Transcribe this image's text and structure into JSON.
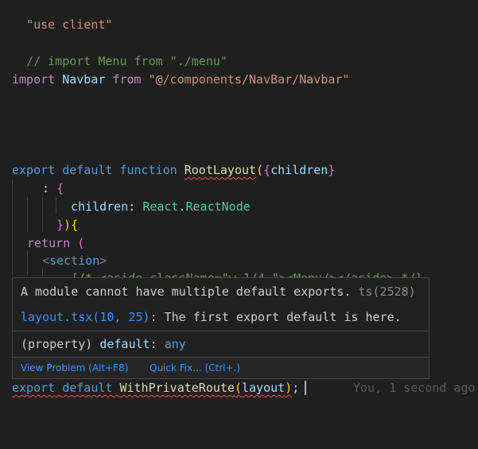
{
  "editor": {
    "l1": {
      "text": "\"use client\""
    },
    "l2": {
      "text": "// import Menu from \"./menu\""
    },
    "l3": {
      "kw": "import",
      "name": "Navbar",
      "from": "from",
      "path": "\"@/components/NavBar/Navbar\""
    },
    "l4": {
      "export": "export",
      "default": "default",
      "function": "function",
      "fname": "RootLayout",
      "open": "(",
      "brace": "{",
      "param": "children",
      "close_brace": "}"
    },
    "l5": {
      "colon": ": ",
      "brace": "{"
    },
    "l6": {
      "prop": "children",
      "colon": ": ",
      "ns": "React",
      "dot": ".",
      "type": "ReactNode"
    },
    "l7": {
      "close": "}",
      "paren": ")",
      "brace": "{"
    },
    "l8": {
      "ret": "return",
      "paren": " ("
    },
    "l9": {
      "lt": "<",
      "tag": "section",
      "gt": ">"
    },
    "l10": {
      "text": "{/* <aside className=\"w-1/4 \"><Menu/></aside> */}"
    },
    "last": {
      "export": "export",
      "default": "default",
      "fn": "WithPrivateRoute",
      "open": "(",
      "arg": "layout",
      "close": ")",
      "semi": ";"
    },
    "blame": "You, 1 second ago"
  },
  "hover": {
    "message": "A module cannot have multiple default exports.",
    "code": "ts(2528)",
    "related_link": "layout.tsx(10, 25)",
    "related_text": ": The first export default is here.",
    "sig_property": "(property)",
    "sig_name": "default",
    "sig_colon": ":",
    "sig_type": "any",
    "view_problem": "View Problem (Alt+F8)",
    "quick_fix": "Quick Fix... (Ctrl+.)"
  }
}
